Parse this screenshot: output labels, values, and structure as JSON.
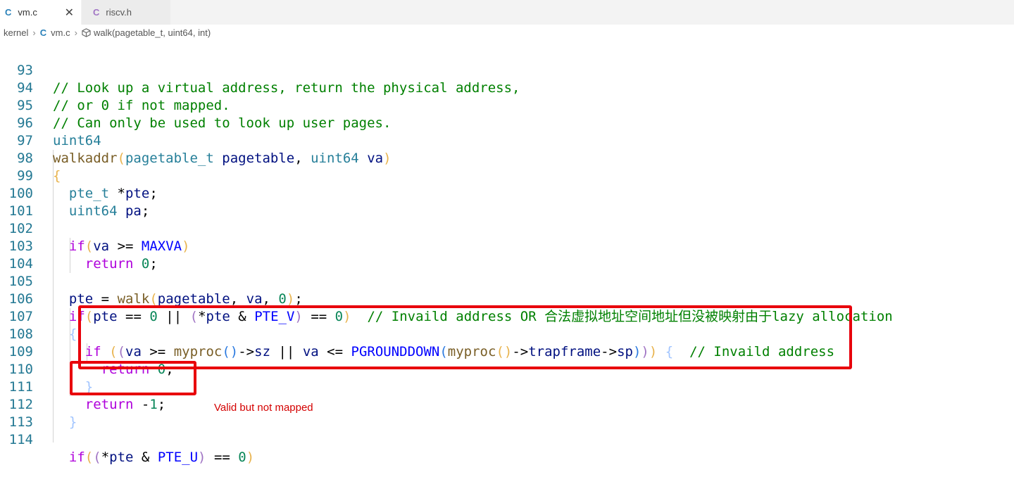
{
  "tabs": [
    {
      "icon": "C",
      "label": "vm.c",
      "close": "✕"
    },
    {
      "icon": "C",
      "label": "riscv.h"
    }
  ],
  "breadcrumb": {
    "folder": "kernel",
    "file_icon": "C",
    "file": "vm.c",
    "symbol": "walk(pagetable_t, uint64, int)"
  },
  "lines": [
    {
      "n": "93"
    },
    {
      "n": "94"
    },
    {
      "n": "95"
    },
    {
      "n": "96"
    },
    {
      "n": "97"
    },
    {
      "n": "98"
    },
    {
      "n": "99"
    },
    {
      "n": "100"
    },
    {
      "n": "101"
    },
    {
      "n": "102"
    },
    {
      "n": "103"
    },
    {
      "n": "104"
    },
    {
      "n": "105"
    },
    {
      "n": "106"
    },
    {
      "n": "107"
    },
    {
      "n": "108"
    },
    {
      "n": "109"
    },
    {
      "n": "110"
    },
    {
      "n": "111"
    },
    {
      "n": "112"
    },
    {
      "n": "113"
    },
    {
      "n": "114"
    }
  ],
  "code": {
    "l93": "// Look up a virtual address, return the physical address,",
    "l94": "// or 0 if not mapped.",
    "l95": "// Can only be used to look up user pages.",
    "l96": "uint64",
    "l106_comment": "// Invaild address OR 合法虚拟地址空间地址但没被映射由于lazy allocation",
    "l108_comment": "// Invaild address"
  },
  "annotation": "Valid but not mapped",
  "colors": {
    "annotation_box": "#e8000b",
    "comment": "#008000",
    "keyword": "#0000ff",
    "control": "#af00db",
    "type": "#267f99",
    "function": "#795e26",
    "line_number": "#237893"
  }
}
